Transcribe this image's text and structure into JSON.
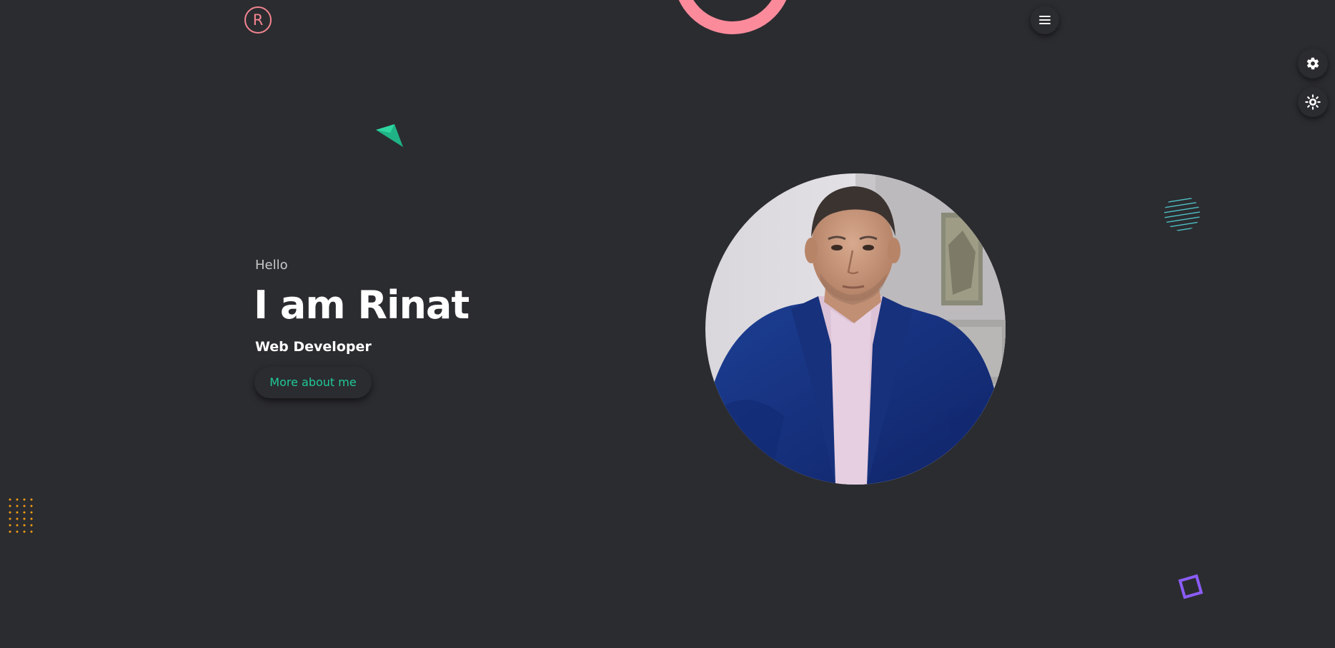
{
  "logo": {
    "letter": "R"
  },
  "hero": {
    "greeting": "Hello",
    "name": "I am Rinat",
    "role": "Web Developer",
    "cta_label": "More about me"
  },
  "icons": {
    "menu": "hamburger-icon",
    "settings": "gear-icon",
    "theme": "sun-icon"
  },
  "colors": {
    "background": "#2b2c30",
    "accent_pink": "#fb8b9b",
    "accent_green": "#20c997",
    "accent_orange": "#f39c12",
    "accent_purple": "#8b5cf6",
    "accent_teal": "#4fc3c7"
  }
}
